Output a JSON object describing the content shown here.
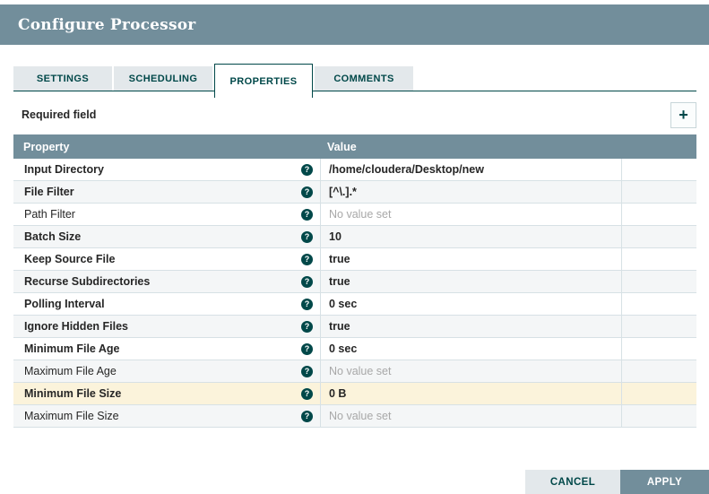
{
  "dialog": {
    "title": "Configure Processor"
  },
  "tabs": [
    {
      "label": "SETTINGS",
      "active": false
    },
    {
      "label": "SCHEDULING",
      "active": false
    },
    {
      "label": "PROPERTIES",
      "active": true
    },
    {
      "label": "COMMENTS",
      "active": false
    }
  ],
  "properties_tab": {
    "required_field_label": "Required field",
    "add_property_icon": "plus-icon",
    "add_property_glyph": "+"
  },
  "table": {
    "columns": [
      "Property",
      "Value"
    ],
    "help_icon_glyph": "?",
    "empty_value_text": "No value set",
    "rows": [
      {
        "property": "Input Directory",
        "required": true,
        "value": "/home/cloudera/Desktop/new",
        "value_set": true,
        "highlighted": false
      },
      {
        "property": "File Filter",
        "required": true,
        "value": "[^\\.].*",
        "value_set": true,
        "highlighted": false
      },
      {
        "property": "Path Filter",
        "required": false,
        "value": "No value set",
        "value_set": false,
        "highlighted": false
      },
      {
        "property": "Batch Size",
        "required": true,
        "value": "10",
        "value_set": true,
        "highlighted": false
      },
      {
        "property": "Keep Source File",
        "required": true,
        "value": "true",
        "value_set": true,
        "highlighted": false
      },
      {
        "property": "Recurse Subdirectories",
        "required": true,
        "value": "true",
        "value_set": true,
        "highlighted": false
      },
      {
        "property": "Polling Interval",
        "required": true,
        "value": "0 sec",
        "value_set": true,
        "highlighted": false
      },
      {
        "property": "Ignore Hidden Files",
        "required": true,
        "value": "true",
        "value_set": true,
        "highlighted": false
      },
      {
        "property": "Minimum File Age",
        "required": true,
        "value": "0 sec",
        "value_set": true,
        "highlighted": false
      },
      {
        "property": "Maximum File Age",
        "required": false,
        "value": "No value set",
        "value_set": false,
        "highlighted": false
      },
      {
        "property": "Minimum File Size",
        "required": true,
        "value": "0 B",
        "value_set": true,
        "highlighted": true
      },
      {
        "property": "Maximum File Size",
        "required": false,
        "value": "No value set",
        "value_set": false,
        "highlighted": false
      }
    ]
  },
  "footer": {
    "cancel_label": "CANCEL",
    "apply_label": "APPLY"
  },
  "colors": {
    "header_bg": "#728E9B",
    "accent_dark_teal": "#004849",
    "inactive_tab_bg": "#E3E8EB",
    "row_alt_bg": "#F4F6F7",
    "row_highlight_bg": "#FBF3DB",
    "row_border": "#D7E1E5",
    "muted_text": "#A8A8A8",
    "apply_button_bg": "#728E9B",
    "cancel_button_bg": "#E3E8EB"
  }
}
